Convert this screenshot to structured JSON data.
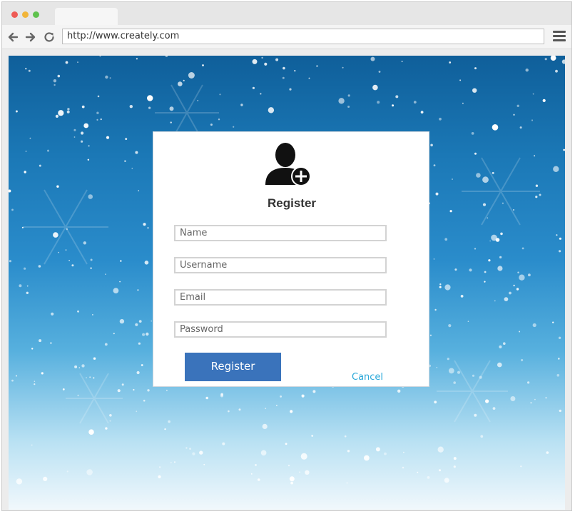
{
  "browser": {
    "url": "http://www.creately.com",
    "window_controls": [
      "close",
      "minimize",
      "maximize"
    ],
    "icons": {
      "back": "arrow-left-icon",
      "forward": "arrow-right-icon",
      "reload": "reload-icon",
      "menu": "hamburger-menu-icon"
    }
  },
  "form": {
    "title": "Register",
    "avatar_icon": "user-add-icon",
    "fields": [
      {
        "placeholder": "Name"
      },
      {
        "placeholder": "Username"
      },
      {
        "placeholder": "Email"
      },
      {
        "placeholder": "Password"
      }
    ],
    "submit_label": "Register",
    "cancel_label": "Cancel"
  },
  "colors": {
    "primary_button": "#3a73bb",
    "cancel_link": "#2aa8d9",
    "background_top": "#0f5f9a",
    "background_bottom": "#f1f8fc"
  }
}
